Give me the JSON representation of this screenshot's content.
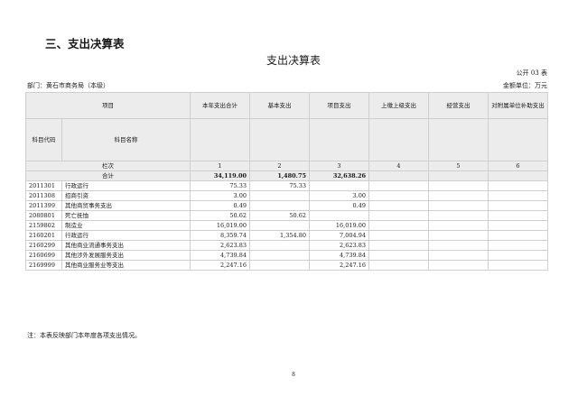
{
  "section_title": "三、支出决算表",
  "doc_title": "支出决算表",
  "form_code": "公开 03 表",
  "department": "部门：黄石市商务局（本级）",
  "unit": "金额单位：万元",
  "table": {
    "header_item": "项目",
    "subject_code_header": "科目代码",
    "subject_name_header": "科目名称",
    "columns": [
      "本年支出合计",
      "基本支出",
      "项目支出",
      "上缴上级支出",
      "经营支出",
      "对附属单位补助支出"
    ],
    "column_label": "栏次",
    "column_numbers": [
      "1",
      "2",
      "3",
      "4",
      "5",
      "6"
    ],
    "total_label": "合计",
    "total_values": [
      "34,119.00",
      "1,480.75",
      "32,638.26",
      "",
      "",
      ""
    ],
    "rows": [
      {
        "code": "2011301",
        "name": "行政运行",
        "values": [
          "75.33",
          "75.33",
          "",
          "",
          "",
          ""
        ]
      },
      {
        "code": "2011308",
        "name": "招商引资",
        "values": [
          "3.00",
          "",
          "3.00",
          "",
          "",
          ""
        ]
      },
      {
        "code": "2011399",
        "name": "其他商贸事务支出",
        "values": [
          "0.49",
          "",
          "0.49",
          "",
          "",
          ""
        ]
      },
      {
        "code": "2080801",
        "name": "死亡抚恤",
        "values": [
          "50.62",
          "50.62",
          "",
          "",
          "",
          ""
        ]
      },
      {
        "code": "2159802",
        "name": "制造业",
        "values": [
          "16,019.00",
          "",
          "16,019.00",
          "",
          "",
          ""
        ]
      },
      {
        "code": "2160201",
        "name": "行政运行",
        "values": [
          "8,359.74",
          "1,354.80",
          "7,004.94",
          "",
          "",
          ""
        ]
      },
      {
        "code": "2160299",
        "name": "其他商业流通事务支出",
        "values": [
          "2,623.83",
          "",
          "2,623.83",
          "",
          "",
          ""
        ]
      },
      {
        "code": "2160699",
        "name": "其他涉外发展服务支出",
        "values": [
          "4,739.84",
          "",
          "4,739.84",
          "",
          "",
          ""
        ]
      },
      {
        "code": "2169999",
        "name": "其他商业服务业等支出",
        "values": [
          "2,247.16",
          "",
          "2,247.16",
          "",
          "",
          ""
        ]
      }
    ]
  },
  "note": "注：本表反映部门本年度各项支出情况。",
  "page_number": "8"
}
